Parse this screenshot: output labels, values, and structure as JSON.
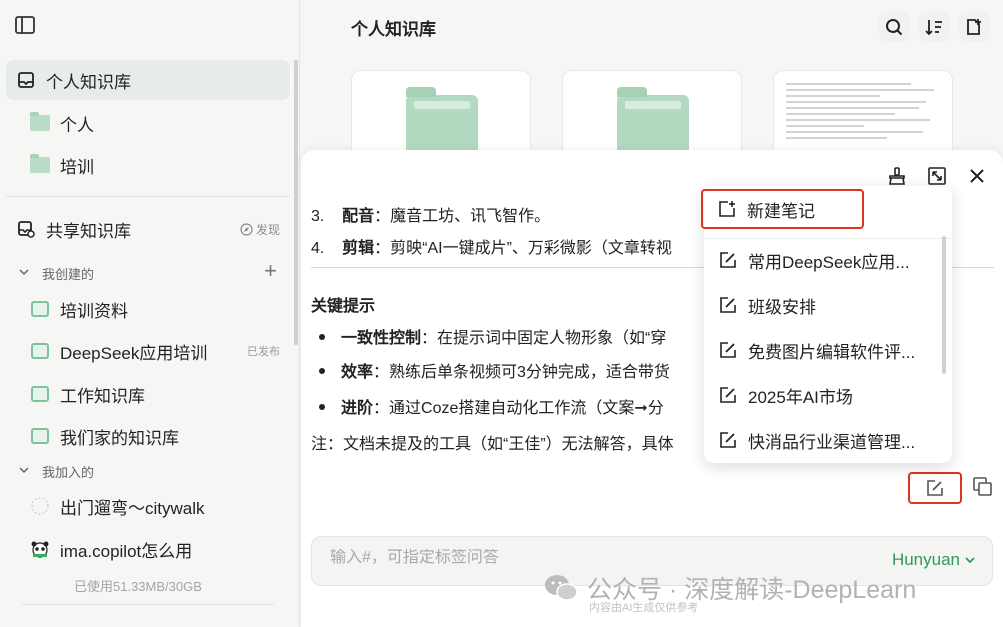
{
  "sidebar": {
    "personal_kb": "个人知识库",
    "folders": [
      "个人",
      "培训"
    ],
    "shared_kb": "共享知识库",
    "discover": "发现",
    "created_group": "我创建的",
    "created_items": [
      {
        "label": "培训资料",
        "badge": ""
      },
      {
        "label": "DeepSeek应用培训",
        "badge": "已发布"
      },
      {
        "label": "工作知识库",
        "badge": ""
      },
      {
        "label": "我们家的知识库",
        "badge": ""
      }
    ],
    "joined_group": "我加入的",
    "joined_items": [
      "出门遛弯～citywalk",
      "ima.copilot怎么用"
    ],
    "usage": "已使用51.33MB/30GB"
  },
  "main": {
    "title": "个人知识库"
  },
  "content": {
    "line1_num": "3.",
    "line1_bold": "配音",
    "line1_text": "：魔音工坊、讯飞智作。",
    "line2_num": "4.",
    "line2_bold": "剪辑",
    "line2_text": "：剪映“AI一键成片”、万彩微影（文章转视",
    "section_title": "关键提示",
    "bullet1_bold": "一致性控制",
    "bullet1_text": "：在提示词中固定人物形象（如“穿",
    "bullet2_bold": "效率",
    "bullet2_text": "：熟练后单条视频可3分钟完成，适合带货",
    "bullet3_bold": "进阶",
    "bullet3_text": "：通过Coze搭建自动化工作流（文案➞分",
    "note": "注：文档未提及的工具（如“王佳”）无法解答，具体"
  },
  "input": {
    "placeholder": "输入#，可指定标签问答",
    "model": "Hunyuan"
  },
  "popup": {
    "new_note": "新建笔记",
    "items": [
      "常用DeepSeek应用...",
      "班级安排",
      "免费图片编辑软件评...",
      "2025年AI市场",
      "快消品行业渠道管理..."
    ]
  },
  "watermark": {
    "text": "公众号 · 深度解读-DeepLearn",
    "sub": "内容由AI生成仅供参考"
  },
  "colors": {
    "accent_green": "#2f9a5b",
    "highlight_red": "#e0341f"
  }
}
